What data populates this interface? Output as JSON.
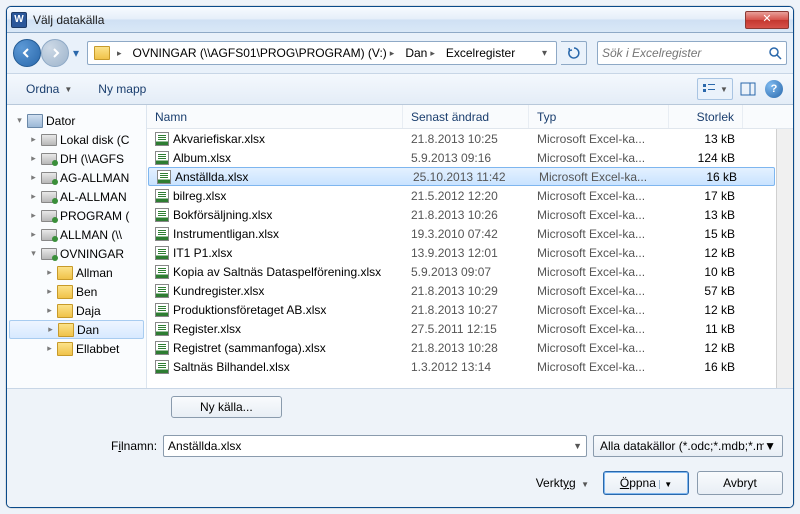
{
  "title": "Välj datakälla",
  "breadcrumb": {
    "root_drop": "▸",
    "items": [
      {
        "label": "OVNINGAR (\\\\AGFS01\\PROG\\PROGRAM) (V:)"
      },
      {
        "label": "Dan"
      },
      {
        "label": "Excelregister"
      }
    ]
  },
  "search": {
    "placeholder": "Sök i Excelregister"
  },
  "toolbar": {
    "organize": "Ordna",
    "newfolder": "Ny mapp"
  },
  "tree": [
    {
      "label": "Dator",
      "level": 0,
      "icon": "computer",
      "exp": "▾"
    },
    {
      "label": "Lokal disk (C",
      "level": 1,
      "icon": "drive",
      "exp": "▸"
    },
    {
      "label": "DH (\\\\AGFS",
      "level": 1,
      "icon": "netdrive",
      "exp": "▸"
    },
    {
      "label": "AG-ALLMAN",
      "level": 1,
      "icon": "netdrive",
      "exp": "▸"
    },
    {
      "label": "AL-ALLMAN",
      "level": 1,
      "icon": "netdrive",
      "exp": "▸"
    },
    {
      "label": "PROGRAM (",
      "level": 1,
      "icon": "netdrive",
      "exp": "▸"
    },
    {
      "label": "ALLMAN (\\\\",
      "level": 1,
      "icon": "netdrive",
      "exp": "▸"
    },
    {
      "label": "OVNINGAR",
      "level": 1,
      "icon": "netdrive",
      "exp": "▾"
    },
    {
      "label": "Allman",
      "level": 2,
      "icon": "folder",
      "exp": "▸"
    },
    {
      "label": "Ben",
      "level": 2,
      "icon": "folder",
      "exp": "▸"
    },
    {
      "label": "Daja",
      "level": 2,
      "icon": "folder",
      "exp": "▸"
    },
    {
      "label": "Dan",
      "level": 2,
      "icon": "folder",
      "exp": "▸",
      "sel": true
    },
    {
      "label": "Ellabbet",
      "level": 2,
      "icon": "folder",
      "exp": "▸"
    }
  ],
  "columns": {
    "name": "Namn",
    "date": "Senast ändrad",
    "type": "Typ",
    "size": "Storlek"
  },
  "files": [
    {
      "name": "Akvariefiskar.xlsx",
      "date": "21.8.2013 10:25",
      "type": "Microsoft Excel-ka...",
      "size": "13 kB"
    },
    {
      "name": "Album.xlsx",
      "date": "5.9.2013 09:16",
      "type": "Microsoft Excel-ka...",
      "size": "124 kB"
    },
    {
      "name": "Anställda.xlsx",
      "date": "25.10.2013 11:42",
      "type": "Microsoft Excel-ka...",
      "size": "16 kB",
      "sel": true
    },
    {
      "name": "bilreg.xlsx",
      "date": "21.5.2012 12:20",
      "type": "Microsoft Excel-ka...",
      "size": "17 kB"
    },
    {
      "name": "Bokförsäljning.xlsx",
      "date": "21.8.2013 10:26",
      "type": "Microsoft Excel-ka...",
      "size": "13 kB"
    },
    {
      "name": "Instrumentligan.xlsx",
      "date": "19.3.2010 07:42",
      "type": "Microsoft Excel-ka...",
      "size": "15 kB"
    },
    {
      "name": "IT1 P1.xlsx",
      "date": "13.9.2013 12:01",
      "type": "Microsoft Excel-ka...",
      "size": "12 kB"
    },
    {
      "name": "Kopia av Saltnäs Dataspelförening.xlsx",
      "date": "5.9.2013 09:07",
      "type": "Microsoft Excel-ka...",
      "size": "10 kB"
    },
    {
      "name": "Kundregister.xlsx",
      "date": "21.8.2013 10:29",
      "type": "Microsoft Excel-ka...",
      "size": "57 kB"
    },
    {
      "name": "Produktionsföretaget AB.xlsx",
      "date": "21.8.2013 10:27",
      "type": "Microsoft Excel-ka...",
      "size": "12 kB"
    },
    {
      "name": "Register.xlsx",
      "date": "27.5.2011 12:15",
      "type": "Microsoft Excel-ka...",
      "size": "11 kB"
    },
    {
      "name": "Registret (sammanfoga).xlsx",
      "date": "21.8.2013 10:28",
      "type": "Microsoft Excel-ka...",
      "size": "12 kB"
    },
    {
      "name": "Saltnäs Bilhandel.xlsx",
      "date": "1.3.2012 13:14",
      "type": "Microsoft Excel-ka...",
      "size": "16 kB"
    }
  ],
  "newsource": "Ny källa...",
  "filename_label_pre": "F",
  "filename_label_u": "i",
  "filename_label_post": "lnamn:",
  "filename_value": "Anställda.xlsx",
  "filetype": "Alla datakällor (*.odc;*.mdb;*.m",
  "tools_label_pre": "Verkt",
  "tools_label_u": "y",
  "tools_label_post": "g",
  "open_pre": "",
  "open_u": "Ö",
  "open_post": "ppna",
  "cancel": "Avbryt"
}
